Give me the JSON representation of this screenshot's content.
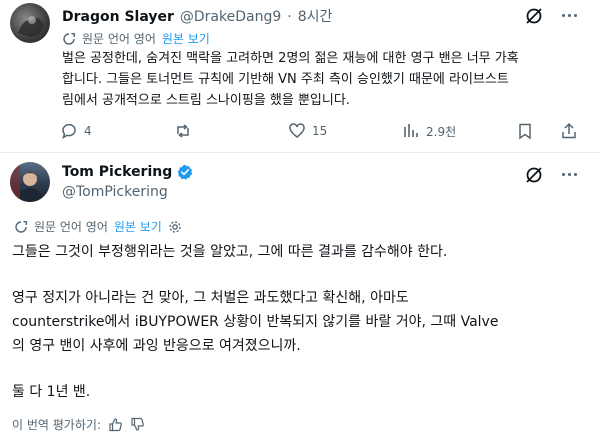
{
  "reply": {
    "author_name": "Dragon Slayer",
    "handle": "@DrakeDang9",
    "separator": "·",
    "time": "8시간",
    "translation_note": "원문 언어 영어",
    "show_original": "원본 보기",
    "body_lines": [
      "벌은 공정한데, 숨겨진 맥락을 고려하면 2명의 젊은 재능에 대한 영구 밴은 너무 가혹",
      "합니다. 그들은 토너먼트 규칙에 기반해 VN 주최 측이 승인했기 때문에 라이브스트",
      "림에서 공개적으로 스트림 스나이핑을 했을 뿐입니다."
    ],
    "actions": {
      "reply_count": "4",
      "repost_count": "",
      "like_count": "15",
      "views_count": "2.9천"
    }
  },
  "main": {
    "author_name": "Tom Pickering",
    "handle": "@TomPickering",
    "verified_color": "#1d9bf0",
    "translation_note": "원문 언어 영어",
    "show_original": "원본 보기",
    "body_lines": [
      "그들은 그것이 부정행위라는 것을 알았고, 그에 따른 결과를 감수해야 한다.",
      "",
      "영구 정지가 아니라는 건 맞아, 그 처벌은 과도했다고 확신해, 아마도",
      "counterstrike에서 iBUYPOWER 상황이 반복되지 않기를 바랄 거야, 그때 Valve",
      "의 영구 밴이 사후에 과잉 반응으로 여겨졌으니까.",
      "",
      "둘 다 1년 밴."
    ],
    "rate_translation": "이 번역 평가하기:"
  },
  "colors": {
    "accent": "#1d9bf0",
    "muted": "#536471",
    "text": "#0f1419"
  }
}
